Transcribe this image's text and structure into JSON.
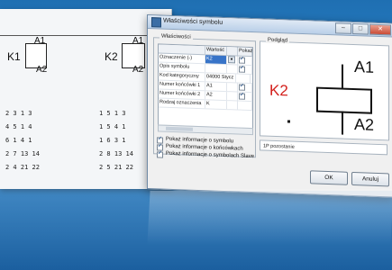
{
  "background_sheet": {
    "left_coil": {
      "name": "K1",
      "top_terminal": "A1",
      "bottom_terminal": "A2"
    },
    "right_coil": {
      "name": "K2",
      "top_terminal": "A1",
      "bottom_terminal": "A2"
    },
    "left_contacts": [
      "2 3 1 3",
      "4 5 1 4",
      "6 1 4 1",
      "2 7 13 14",
      "2 4 21 22"
    ],
    "right_contacts": [
      "1 5 1 3",
      "1 5 4 1",
      "1 6 3 1",
      "2 8 13 14",
      "2 5 21 22"
    ]
  },
  "dialog": {
    "title": "Właściwości symbolu",
    "minimize": "–",
    "maximize": "□",
    "close": "✕",
    "properties_group": "Właściwości",
    "columns": [
      "",
      "Wartość",
      "Pokaż"
    ],
    "rows": [
      {
        "name": "Oznaczenie (-)",
        "value": "K2",
        "show": true,
        "selected": true
      },
      {
        "name": "Opis symbolu",
        "value": "",
        "show": true,
        "selected": false
      },
      {
        "name": "Kod kategoryczny",
        "value": "04000 Stycz",
        "show": false,
        "selected": false
      },
      {
        "name": "Numer końcówki 1",
        "value": "A1",
        "show": true,
        "selected": false
      },
      {
        "name": "Numer końcówki 2",
        "value": "A2",
        "show": true,
        "selected": false
      },
      {
        "name": "Rodzaj oznaczenia",
        "value": "K",
        "show": false,
        "selected": false
      }
    ],
    "options": [
      "Pokaż informacje o symbolu",
      "Pokaż informacje o końcówkach",
      "Pokaż informacje o symbolach Slave"
    ],
    "preview_group": "Podgląd",
    "preview": {
      "designation": "K2",
      "terminal_top": "A1",
      "terminal_bottom": "A2"
    },
    "status_text": "1P pozostanie",
    "ok_label": "OK",
    "cancel_label": "Anuluj"
  },
  "colors": {
    "accent_red": "#d3201c",
    "background_blue": "#2b86cc"
  }
}
